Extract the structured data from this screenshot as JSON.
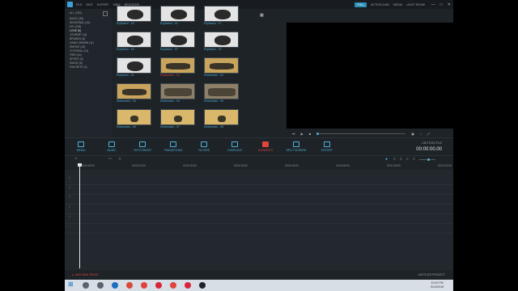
{
  "menubar": {
    "items": [
      "FILE",
      "EDIT",
      "EXPORT",
      "VIEW",
      "REGISTER"
    ],
    "modes": [
      {
        "label": "FULL",
        "active": true
      },
      {
        "label": "ACTION CAM",
        "active": false
      },
      {
        "label": "MEDIA",
        "active": false
      },
      {
        "label": "LIGHT ROOM",
        "active": false
      }
    ],
    "window_controls": [
      "—",
      "□",
      "✕"
    ]
  },
  "sidebar": {
    "header": "ALL (153)",
    "items": [
      "BASIC (36)",
      "SEASONAL (16)",
      "DIY (118)",
      "LOVE (6)",
      "JOURNEY (6)",
      "BRANDS (6)",
      "HAND DRAWN (11)",
      "SMOKE (10)",
      "TUTORIAL (11)",
      "FIRE (16)",
      "SPORT (6)",
      "MAGIC (6)",
      "FAVORITE (0)"
    ],
    "selected_index": 3
  },
  "browser": {
    "tiles": [
      {
        "label": "Explosion - 15",
        "style": "expl"
      },
      {
        "label": "Explosion - 16",
        "style": "expl"
      },
      {
        "label": "Explosion - 17",
        "style": "expl"
      },
      {
        "label": "Explosion - 18",
        "style": "expl"
      },
      {
        "label": "Explosion - 19",
        "style": "expl"
      },
      {
        "label": "Explosion - 20",
        "style": "expl"
      },
      {
        "label": "Explosion - 21",
        "style": "expl"
      },
      {
        "label": "Destruction - 01",
        "style": "dest"
      },
      {
        "label": "Destruction - 02",
        "style": "dest"
      },
      {
        "label": "Destruction - 03",
        "style": "dest"
      },
      {
        "label": "Destruction - 04",
        "style": "dest2"
      },
      {
        "label": "Destruction - 05",
        "style": "dest2"
      },
      {
        "label": "Destruction - 06",
        "style": "sand"
      },
      {
        "label": "Destruction - 07",
        "style": "sand"
      },
      {
        "label": "Destruction - 08",
        "style": "sand"
      }
    ],
    "label_color": "#4cb2d9",
    "highlight_label_color": "#e0443c"
  },
  "preview": {
    "controls": [
      "⏮",
      "▶",
      "■"
    ],
    "right_controls": [
      "▣",
      "♪",
      "⤢"
    ],
    "progress": 0.0
  },
  "tabs": [
    {
      "label": "MEDIA",
      "active": false
    },
    {
      "label": "MUSIC",
      "active": false
    },
    {
      "label": "TEXT/CREDIT",
      "active": false
    },
    {
      "label": "TRANSITIONS",
      "active": false
    },
    {
      "label": "FILTERS",
      "active": false
    },
    {
      "label": "OVERLAYS",
      "active": false
    },
    {
      "label": "ELEMENTS",
      "active": true
    },
    {
      "label": "SPLIT SCREEN",
      "active": false
    },
    {
      "label": "EXPORT",
      "active": false
    }
  ],
  "timecode": {
    "label": "UNTITLED FILE",
    "value": "00:00:00.00"
  },
  "toolbar": {
    "left_icons": [
      "↶",
      "✂",
      "✕"
    ],
    "right_icons": [
      "●",
      "≡",
      "≡",
      "≡",
      "≡"
    ]
  },
  "ruler": {
    "ticks": [
      "00:00:00:00",
      "00:00:10:00",
      "00:00:20:00",
      "00:00:30:00",
      "00:00:40:00",
      "00:00:50:00",
      "00:01:00:00",
      "00:01:10:00"
    ]
  },
  "tracks": [
    "1",
    "1",
    "T",
    "1",
    "1",
    "♪"
  ],
  "statusbar": {
    "add_track": "ADD NEW TRACK",
    "project": "UNTITLED PROJECT"
  },
  "taskbar": {
    "icons": [
      {
        "name": "search",
        "color": "#5a6470"
      },
      {
        "name": "task-view",
        "color": "#5a6470"
      },
      {
        "name": "edge",
        "color": "#1c6fbf"
      },
      {
        "name": "chrome",
        "color": "#d94a3a"
      },
      {
        "name": "media",
        "color": "#e0443c"
      },
      {
        "name": "opera",
        "color": "#d9253a"
      },
      {
        "name": "app",
        "color": "#e0443c"
      },
      {
        "name": "opera-2",
        "color": "#d9253a"
      },
      {
        "name": "filmora",
        "color": "#1e2328"
      }
    ],
    "time": "12:00 PM",
    "date": "9/13/2018"
  }
}
